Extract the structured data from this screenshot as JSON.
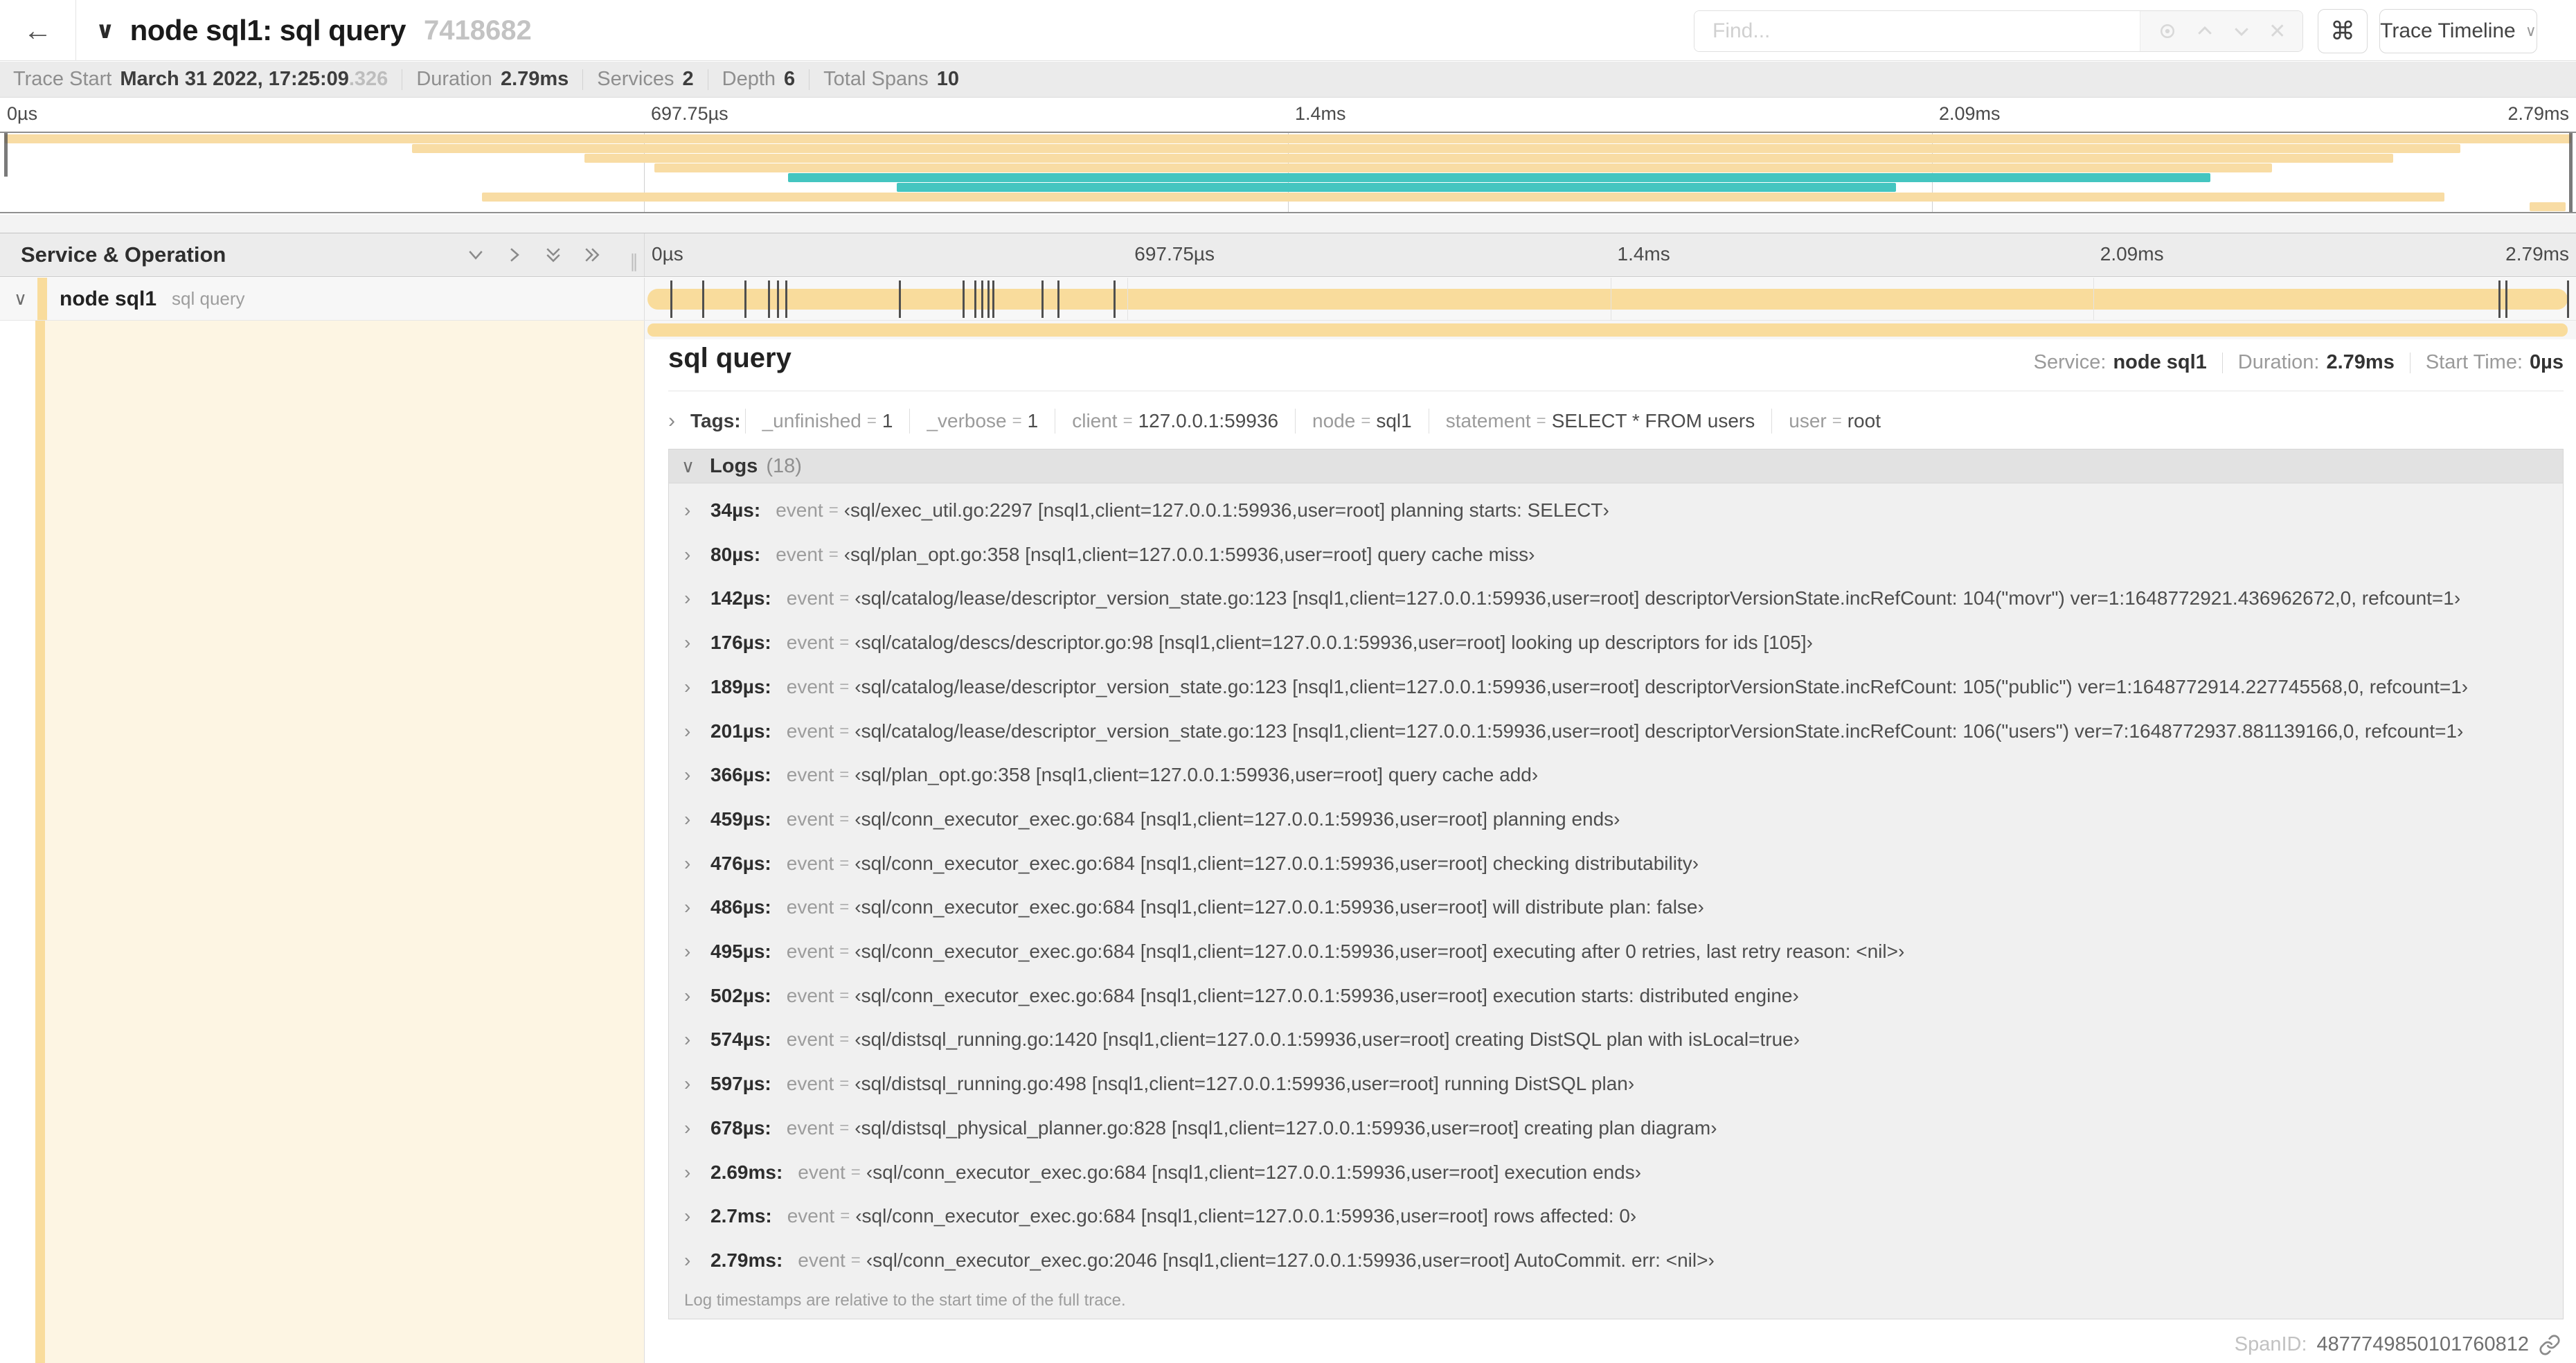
{
  "header": {
    "back_icon": "←",
    "collapse_icon": "∨",
    "title": "node sql1: sql query",
    "trace_id": "7418682",
    "find_placeholder": "Find...",
    "clear_icon": "✕",
    "keyboard_icon": "⌘",
    "view_selector_label": "Trace Timeline",
    "view_selector_chevron": "∨"
  },
  "summary": {
    "items": [
      {
        "label": "Trace Start",
        "value": "March 31 2022, 17:25:09",
        "suffix": ".326"
      },
      {
        "label": "Duration",
        "value": "2.79ms"
      },
      {
        "label": "Services",
        "value": "2"
      },
      {
        "label": "Depth",
        "value": "6"
      },
      {
        "label": "Total Spans",
        "value": "10"
      }
    ]
  },
  "minimap": {
    "ticks": [
      "0µs",
      "697.75µs",
      "1.4ms",
      "2.09ms",
      "2.79ms"
    ],
    "colors": {
      "span": "#f8dca4",
      "remote": "#44c5c0"
    },
    "bars": [
      {
        "row": 0,
        "left": 0.2,
        "width": 99.6,
        "color": "span"
      },
      {
        "row": 1,
        "left": 16.0,
        "width": 79.5,
        "color": "span"
      },
      {
        "row": 2,
        "left": 22.7,
        "width": 70.2,
        "color": "span"
      },
      {
        "row": 3,
        "left": 25.4,
        "width": 62.8,
        "color": "span"
      },
      {
        "row": 4,
        "left": 30.6,
        "width": 55.2,
        "color": "remote"
      },
      {
        "row": 5,
        "left": 34.8,
        "width": 38.8,
        "color": "remote"
      },
      {
        "row": 6,
        "left": 18.7,
        "width": 76.2,
        "color": "span"
      },
      {
        "row": 7,
        "left": 98.2,
        "width": 1.4,
        "color": "span"
      }
    ]
  },
  "timeline": {
    "left_header": "Service & Operation",
    "ticks": [
      "0µs",
      "697.75µs",
      "1.4ms",
      "2.09ms",
      "2.79ms"
    ],
    "total_duration_us": 2790,
    "row": {
      "expand_chevron": "∨",
      "service": "node sql1",
      "operation": "sql query"
    },
    "span_color": "#f9dc9c"
  },
  "detail": {
    "title": "sql query",
    "stats": [
      {
        "label": "Service:",
        "value": "node sql1"
      },
      {
        "label": "Duration:",
        "value": "2.79ms"
      },
      {
        "label": "Start Time:",
        "value": "0µs"
      }
    ],
    "tags_chevron": "›",
    "tags_label": "Tags:",
    "tags": [
      {
        "key": "_unfinished",
        "value": "1"
      },
      {
        "key": "_verbose",
        "value": "1"
      },
      {
        "key": "client",
        "value": "127.0.0.1:59936"
      },
      {
        "key": "node",
        "value": "sql1"
      },
      {
        "key": "statement",
        "value": "SELECT * FROM users"
      },
      {
        "key": "user",
        "value": "root"
      }
    ],
    "logs_chevron": "∨",
    "logs_label": "Logs",
    "logs_count": "(18)",
    "log_row_chevron": "›",
    "logs": [
      {
        "us": 34,
        "time": "34µs:",
        "key": "event",
        "value": "‹sql/exec_util.go:2297 [nsql1,client=127.0.0.1:59936,user=root] planning starts: SELECT›"
      },
      {
        "us": 80,
        "time": "80µs:",
        "key": "event",
        "value": "‹sql/plan_opt.go:358 [nsql1,client=127.0.0.1:59936,user=root] query cache miss›"
      },
      {
        "us": 142,
        "time": "142µs:",
        "key": "event",
        "value": "‹sql/catalog/lease/descriptor_version_state.go:123 [nsql1,client=127.0.0.1:59936,user=root] descriptorVersionState.incRefCount: 104(\"movr\") ver=1:1648772921.436962672,0, refcount=1›"
      },
      {
        "us": 176,
        "time": "176µs:",
        "key": "event",
        "value": "‹sql/catalog/descs/descriptor.go:98 [nsql1,client=127.0.0.1:59936,user=root] looking up descriptors for ids [105]›"
      },
      {
        "us": 189,
        "time": "189µs:",
        "key": "event",
        "value": "‹sql/catalog/lease/descriptor_version_state.go:123 [nsql1,client=127.0.0.1:59936,user=root] descriptorVersionState.incRefCount: 105(\"public\") ver=1:1648772914.227745568,0, refcount=1›"
      },
      {
        "us": 201,
        "time": "201µs:",
        "key": "event",
        "value": "‹sql/catalog/lease/descriptor_version_state.go:123 [nsql1,client=127.0.0.1:59936,user=root] descriptorVersionState.incRefCount: 106(\"users\") ver=7:1648772937.881139166,0, refcount=1›"
      },
      {
        "us": 366,
        "time": "366µs:",
        "key": "event",
        "value": "‹sql/plan_opt.go:358 [nsql1,client=127.0.0.1:59936,user=root] query cache add›"
      },
      {
        "us": 459,
        "time": "459µs:",
        "key": "event",
        "value": "‹sql/conn_executor_exec.go:684 [nsql1,client=127.0.0.1:59936,user=root] planning ends›"
      },
      {
        "us": 476,
        "time": "476µs:",
        "key": "event",
        "value": "‹sql/conn_executor_exec.go:684 [nsql1,client=127.0.0.1:59936,user=root] checking distributability›"
      },
      {
        "us": 486,
        "time": "486µs:",
        "key": "event",
        "value": "‹sql/conn_executor_exec.go:684 [nsql1,client=127.0.0.1:59936,user=root] will distribute plan: false›"
      },
      {
        "us": 495,
        "time": "495µs:",
        "key": "event",
        "value": "‹sql/conn_executor_exec.go:684 [nsql1,client=127.0.0.1:59936,user=root] executing after 0 retries, last retry reason: <nil>›"
      },
      {
        "us": 502,
        "time": "502µs:",
        "key": "event",
        "value": "‹sql/conn_executor_exec.go:684 [nsql1,client=127.0.0.1:59936,user=root] execution starts: distributed engine›"
      },
      {
        "us": 574,
        "time": "574µs:",
        "key": "event",
        "value": "‹sql/distsql_running.go:1420 [nsql1,client=127.0.0.1:59936,user=root] creating DistSQL plan with isLocal=true›"
      },
      {
        "us": 597,
        "time": "597µs:",
        "key": "event",
        "value": "‹sql/distsql_running.go:498 [nsql1,client=127.0.0.1:59936,user=root] running DistSQL plan›"
      },
      {
        "us": 678,
        "time": "678µs:",
        "key": "event",
        "value": "‹sql/distsql_physical_planner.go:828 [nsql1,client=127.0.0.1:59936,user=root] creating plan diagram›"
      },
      {
        "us": 2690,
        "time": "2.69ms:",
        "key": "event",
        "value": "‹sql/conn_executor_exec.go:684 [nsql1,client=127.0.0.1:59936,user=root] execution ends›"
      },
      {
        "us": 2700,
        "time": "2.7ms:",
        "key": "event",
        "value": "‹sql/conn_executor_exec.go:684 [nsql1,client=127.0.0.1:59936,user=root] rows affected: 0›"
      },
      {
        "us": 2790,
        "time": "2.79ms:",
        "key": "event",
        "value": "‹sql/conn_executor_exec.go:2046 [nsql1,client=127.0.0.1:59936,user=root] AutoCommit. err: <nil>›"
      }
    ],
    "logs_note": "Log timestamps are relative to the start time of the full trace.",
    "span_id_label": "SpanID:",
    "span_id": "4877749850101760812"
  }
}
